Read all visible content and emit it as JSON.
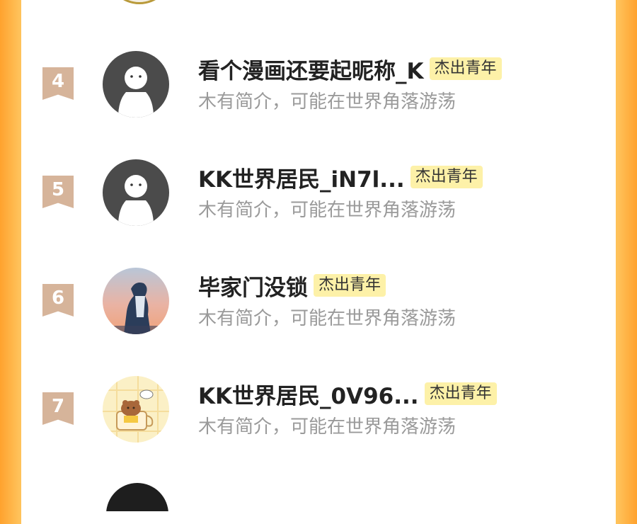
{
  "entries": [
    {
      "rank": "4",
      "name": "看个漫画还要起昵称_K",
      "badge": "杰出青年",
      "bio": "木有简介，可能在世界角落游荡",
      "avatar": "default-ghost-avatar"
    },
    {
      "rank": "5",
      "name": "KK世界居民_iN7l...",
      "badge": "杰出青年",
      "bio": "木有简介，可能在世界角落游荡",
      "avatar": "default-ghost-avatar"
    },
    {
      "rank": "6",
      "name": "毕家门没锁",
      "badge": "杰出青年",
      "bio": "木有简介，可能在世界角落游荡",
      "avatar": "silhouette-sunset-avatar"
    },
    {
      "rank": "7",
      "name": "KK世界居民_0V96...",
      "badge": "杰出青年",
      "bio": "木有简介，可能在世界角落游荡",
      "avatar": "cartoon-animal-avatar"
    }
  ],
  "colors": {
    "background_orange": "#ffc25a",
    "rank_ribbon": "#d6b49a",
    "badge_bg": "#fdf1a8",
    "name_text": "#222222",
    "bio_text": "#9a9a9a"
  }
}
